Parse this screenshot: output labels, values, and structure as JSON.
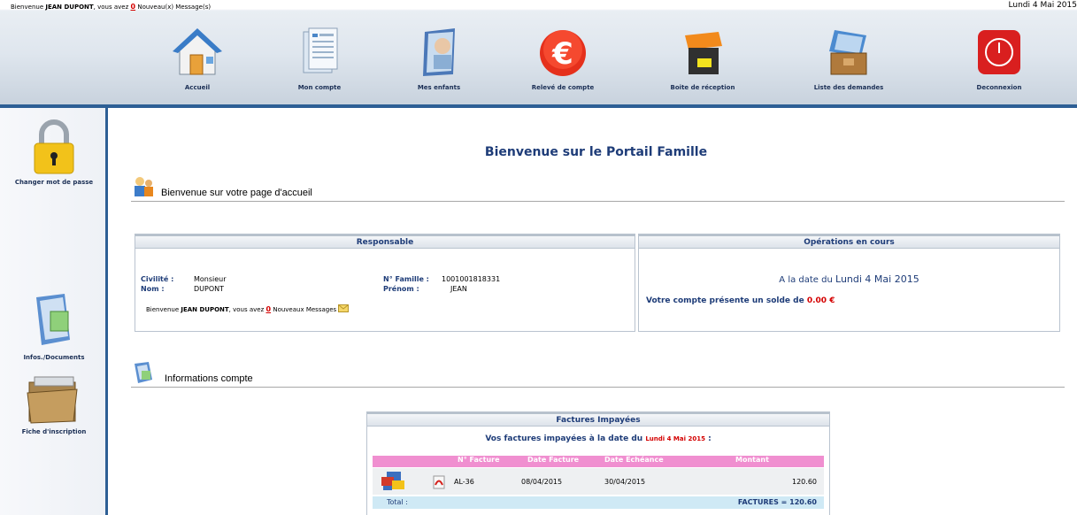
{
  "header": {
    "welcome_prefix": "Bienvenue",
    "user_name": "JEAN DUPONT",
    "welcome_mid": ", vous avez",
    "new_count": "0",
    "welcome_suffix": "Nouveau(x) Message(s)",
    "date": "Lundi 4 Mai 2015"
  },
  "nav": [
    {
      "label": "Accueil",
      "icon": "home-icon"
    },
    {
      "label": "Mon compte",
      "icon": "account-icon"
    },
    {
      "label": "Mes enfants",
      "icon": "children-icon"
    },
    {
      "label": "Relevé de compte",
      "icon": "euro-icon"
    },
    {
      "label": "Boite de réception",
      "icon": "inbox-icon"
    },
    {
      "label": "Liste des demandes",
      "icon": "requests-icon"
    },
    {
      "label": "Deconnexion",
      "icon": "power-icon"
    }
  ],
  "sidebar": [
    {
      "label": "Changer mot de passe",
      "icon": "padlock-icon"
    },
    {
      "label": "Infos./Documents",
      "icon": "documents-icon"
    },
    {
      "label": "Fiche d'inscription",
      "icon": "folder-icon"
    }
  ],
  "main": {
    "title": "Bienvenue sur le Portail Famille",
    "section_home": "Bienvenue sur votre page d'accueil",
    "section_account": "Informations compte"
  },
  "responsable": {
    "title": "Responsable",
    "civilite_label": "Civilité :",
    "civilite": "Monsieur",
    "nom_label": "Nom :",
    "nom": "DUPONT",
    "famille_label": "N° Famille :",
    "famille": "1001001818331",
    "prenom_label": "Prénom :",
    "prenom": "JEAN",
    "msg_prefix": "Bienvenue",
    "msg_name": "JEAN DUPONT",
    "msg_mid": ", vous avez",
    "msg_count": "0",
    "msg_suffix": "Nouveaux Messages"
  },
  "operations": {
    "title": "Opérations en cours",
    "date_prefix": "A la date du",
    "date": "Lundi 4 Mai 2015",
    "solde_text": "Votre compte présente un solde de",
    "solde_value": "0.00 €"
  },
  "factures": {
    "title": "Factures Impayées",
    "subtitle": "Vos factures impayées à la date du",
    "subtitle_date": "Lundi 4 Mai 2015",
    "subtitle_end": ":",
    "columns": [
      "N° Facture",
      "Date Facture",
      "Date Echéance",
      "Montant"
    ],
    "rows": [
      {
        "numero": "AL-36",
        "date_facture": "08/04/2015",
        "date_echeance": "30/04/2015",
        "montant": "120.60"
      }
    ],
    "total_label": "Total :",
    "total_value": "FACTURES = 120.60"
  },
  "colors": {
    "accent": "#2d5f95",
    "title": "#1e3c78",
    "alert": "#d40000",
    "table_header": "#f08fd0"
  }
}
